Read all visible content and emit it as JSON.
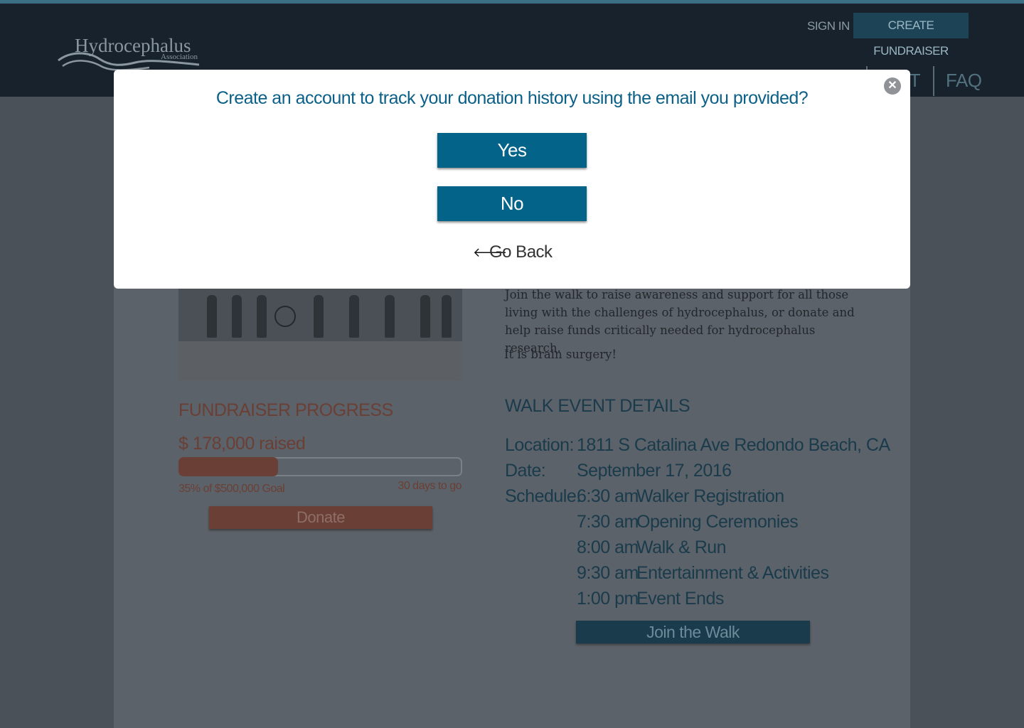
{
  "header": {
    "logo_text": "Hydrocephalus",
    "logo_subtext": "Association",
    "signin_label": "SIGN IN",
    "create_fundraiser_label": "CREATE FUNDRAISER",
    "nav": {
      "about_label": "UT",
      "faq_label": "FAQ"
    }
  },
  "modal": {
    "title": "Create an account to track your donation history using the email you provided?",
    "yes_label": "Yes",
    "no_label": "No",
    "go_back_label": "Go Back",
    "close_icon": "close-icon",
    "back_icon": "arrow-left-icon"
  },
  "fundraiser": {
    "title": "FUNDRAISER PROGRESS",
    "raised": "$ 178,000 raised",
    "progress_fraction": 0.35,
    "percent_of_goal": "35% of $500,000 Goal",
    "days_to_go": "30 days to go",
    "donate_label": "Donate"
  },
  "description": {
    "text": "Join the walk to raise awareness and support for all those living with the challenges of hydrocephalus, or donate and help raise funds critically needed for hydrocephalus research.",
    "tagline": "It is brain surgery!"
  },
  "event": {
    "title": "WALK EVENT DETAILS",
    "location_label": "Location:",
    "location": "1811 S Catalina Ave Redondo Beach, CA",
    "date_label": "Date:",
    "date": "September 17, 2016",
    "schedule_label": "Schedule:",
    "schedule": [
      {
        "time": "6:30 am",
        "activity": "Walker Registration"
      },
      {
        "time": "7:30 am",
        "activity": "Opening Ceremonies"
      },
      {
        "time": "8:00 am",
        "activity": "Walk & Run"
      },
      {
        "time": "9:30 am",
        "activity": "Entertainment & Activities"
      },
      {
        "time": "1:00 pm",
        "activity": "Event Ends"
      }
    ],
    "join_label": "Join the Walk"
  },
  "colors": {
    "accent_blue": "#046388",
    "brand_dark": "#17222c",
    "fundraiser_red": "#a5473a"
  }
}
